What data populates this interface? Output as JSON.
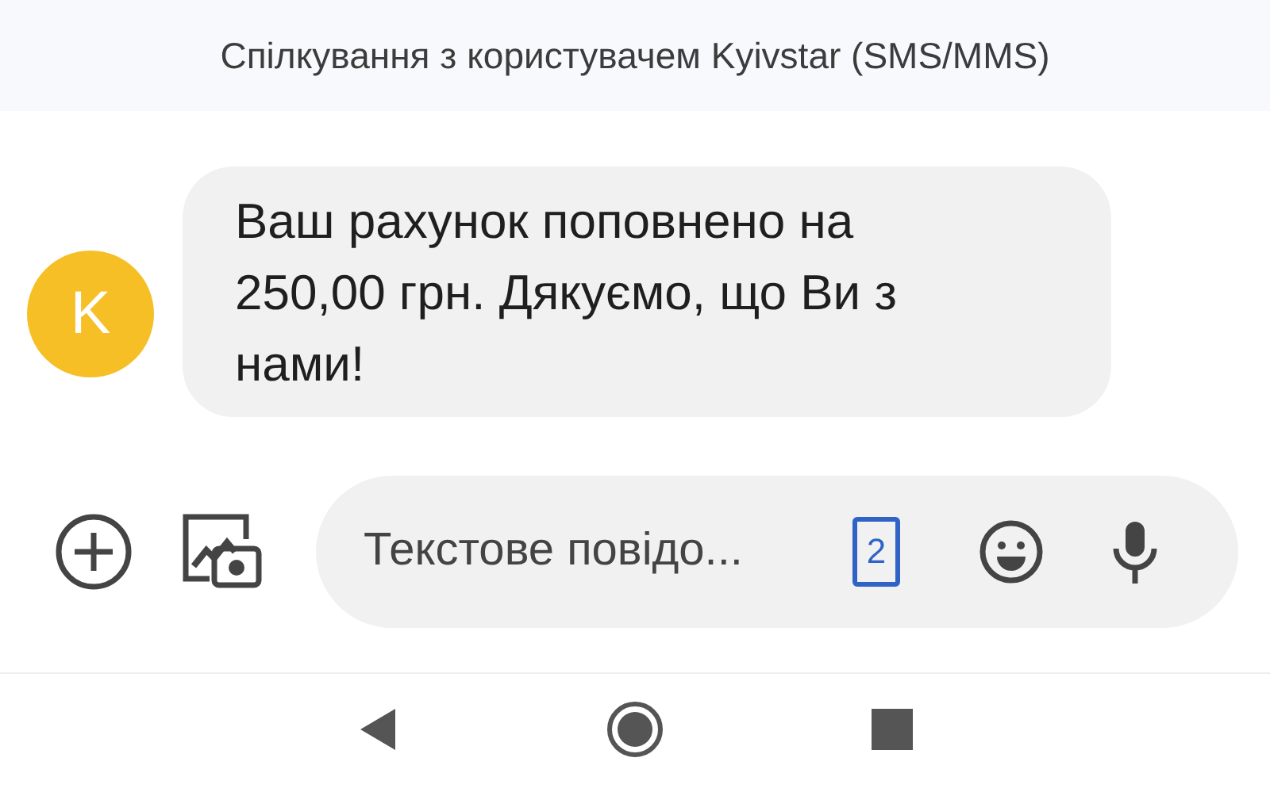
{
  "header": {
    "title": "Спілкування з користувачем Kyivstar (SMS/MMS)"
  },
  "messages": [
    {
      "sender_initial": "K",
      "color": "#f6bf26",
      "text": "Ваш рахунок поповнено на 250,00 грн. Дякуємо, що Ви з нами!"
    }
  ],
  "composer": {
    "placeholder": "Текстове повідо...",
    "sim_slot": "2"
  }
}
